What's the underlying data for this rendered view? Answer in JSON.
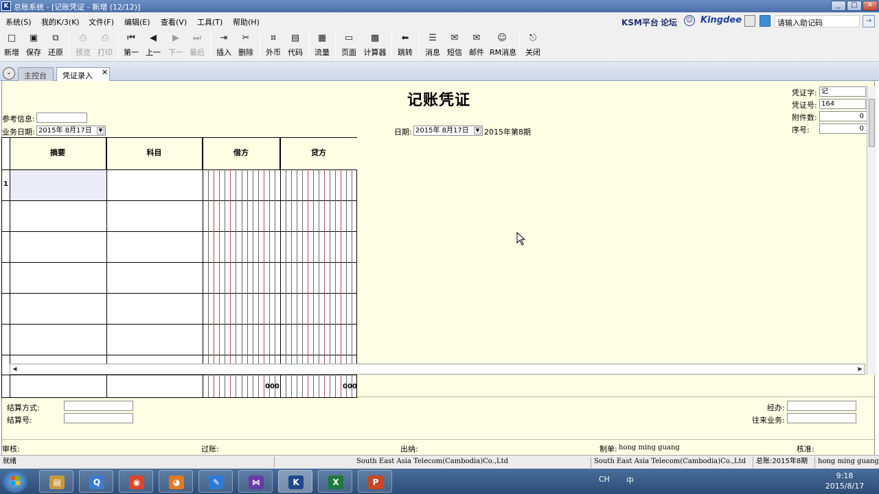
{
  "window": {
    "title": "总账系统 - [记账凭证 - 新增 (12/12)]",
    "app_icon": "K",
    "min_label": "_",
    "max_label": "□",
    "close_label": "✕"
  },
  "menubar": {
    "items": [
      "系统(S)",
      "我的K/3(K)",
      "文件(F)",
      "编辑(E)",
      "查看(V)",
      "工具(T)",
      "帮助(H)"
    ],
    "ksm": "KSM平台",
    "forum": "论坛",
    "brand": "Kingdee",
    "help_code_placeholder": "请输入助记码",
    "help_go": "→"
  },
  "toolbar": {
    "items": [
      {
        "label": "新增",
        "icon": "□"
      },
      {
        "label": "保存",
        "icon": "▣"
      },
      {
        "label": "还原",
        "icon": "⧉"
      },
      {
        "label": "预览",
        "icon": "⎙"
      },
      {
        "label": "打印",
        "icon": "⎙"
      },
      {
        "label": "第一",
        "icon": "⏮"
      },
      {
        "label": "上一",
        "icon": "◀"
      },
      {
        "label": "下一",
        "icon": "▶"
      },
      {
        "label": "最后",
        "icon": "⏭"
      },
      {
        "label": "插入",
        "icon": "⇥"
      },
      {
        "label": "删除",
        "icon": "✂"
      },
      {
        "label": "外币",
        "icon": "¤"
      },
      {
        "label": "代码",
        "icon": "▤"
      },
      {
        "label": "流量",
        "icon": "▦"
      },
      {
        "label": "页面",
        "icon": "▭"
      },
      {
        "label": "计算器",
        "icon": "▩"
      },
      {
        "label": "跳转",
        "icon": "⬅"
      },
      {
        "label": "消息",
        "icon": "☰"
      },
      {
        "label": "短信",
        "icon": "✉"
      },
      {
        "label": "邮件",
        "icon": "✉"
      },
      {
        "label": "RM消息",
        "icon": "☺"
      },
      {
        "label": "关闭",
        "icon": "⎋"
      }
    ]
  },
  "tabs": {
    "toggle": "⌄",
    "items": [
      "主控台",
      "凭证录入"
    ],
    "close": "✕"
  },
  "voucher": {
    "title": "记账凭证",
    "ref_info_label": "参考信息:",
    "ref_info_value": "",
    "biz_date_label": "业务日期:",
    "biz_date_value": "2015年 8月17日",
    "date_label": "日期:",
    "date_value": "2015年 8月17日",
    "period": "2015年第8期",
    "voucher_word_label": "凭证字:",
    "voucher_word_value": "记",
    "voucher_no_label": "凭证号:",
    "voucher_no_value": "164",
    "attachments_label": "附件数:",
    "attachments_value": "0",
    "seq_label": "序号:",
    "seq_value": "0",
    "dropdown_arrow": "▼",
    "spin_up": "▲",
    "spin_down": "▼"
  },
  "grid": {
    "columns": [
      "摘要",
      "科目",
      "借方",
      "贷方"
    ],
    "row_number": "1",
    "debit_total": "000",
    "credit_total": "000",
    "scroll_left": "◀",
    "scroll_right": "▶"
  },
  "footer_fields": {
    "settle_method_label": "结算方式:",
    "settle_no_label": "结算号:",
    "handler_label": "经办:",
    "business_label": "往来业务:"
  },
  "signatures": {
    "audit_label": "审核:",
    "post_label": "过账:",
    "cashier_label": "出纳:",
    "maker_label": "制单:",
    "maker_value": "hong ming guang",
    "approve_label": "核准:"
  },
  "statusbar": {
    "status": "就绪",
    "company_center": "South East Asia Telecom(Cambodia)Co.,Ltd",
    "company_right": "South East Asia Telecom(Cambodia)Co.,Ltd",
    "ledger_period": "总账:2015年8期",
    "user": "hong ming guang"
  },
  "taskbar": {
    "apps": [
      {
        "name": "file-explorer",
        "glyph": "▤",
        "color": "#c89a3c"
      },
      {
        "name": "qq",
        "glyph": "Q",
        "color": "#3d7bd1"
      },
      {
        "name": "chrome",
        "glyph": "◉",
        "color": "#d9452f"
      },
      {
        "name": "firefox",
        "glyph": "◕",
        "color": "#e07a22"
      },
      {
        "name": "pen-app",
        "glyph": "✎",
        "color": "#2f7ad8"
      },
      {
        "name": "visual-studio",
        "glyph": "⋈",
        "color": "#6a3aa8"
      },
      {
        "name": "kingdee-k3",
        "glyph": "K",
        "color": "#1d4a8c"
      },
      {
        "name": "excel",
        "glyph": "X",
        "color": "#1f7a3e"
      },
      {
        "name": "powerpoint",
        "glyph": "P",
        "color": "#c9461e"
      }
    ],
    "tray_text": "CH",
    "ime": "中",
    "time": "9:18",
    "date": "2015/8/17"
  }
}
